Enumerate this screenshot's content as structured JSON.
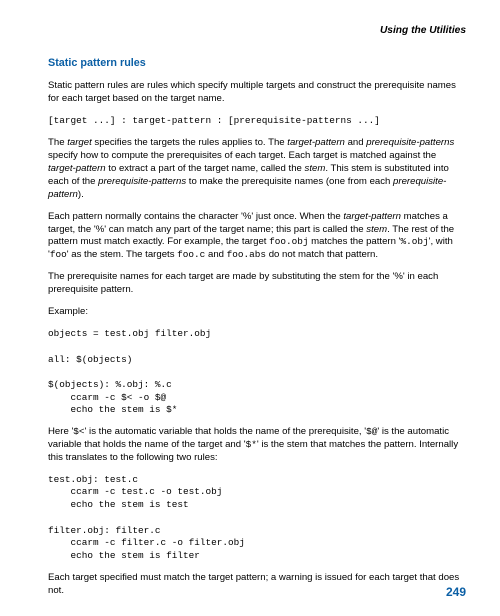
{
  "header": {
    "running_title": "Using the Utilities"
  },
  "section_title": "Static pattern rules",
  "p1": {
    "a": "Static pattern rules are rules which specify multiple targets and construct the prerequisite names for each target based on the target name."
  },
  "code1": "[target ...] : target-pattern : [prerequisite-patterns ...]",
  "p2": {
    "a": "The ",
    "e1": "target",
    "b": " specifies the targets the rules applies to. The ",
    "e2": "target-pattern",
    "c": " and ",
    "e3": "prerequisite-patterns",
    "d": " specify how to compute the prerequisites of each target. Each target is matched against the ",
    "e4": "target-pattern",
    "e": " to extract a part of the target name, called the ",
    "e5": "stem",
    "f": ". This stem is substituted into each of the ",
    "e6": "prerequisite-patterns",
    "g": " to make the prerequisite names (one from each ",
    "e7": "prerequisite-pattern",
    "h": ")."
  },
  "p3": {
    "a": "Each pattern normally contains the character '%' just once. When the ",
    "e1": "target-pattern",
    "b": " matches a target, the '%' can match any part of the target name; this part is called the ",
    "e2": "stem",
    "c": ". The rest of the pattern must match exactly. For example, the target ",
    "t1": "foo.obj",
    "d": " matches the pattern '",
    "t2": "%.obj",
    "e": "', with '",
    "t3": "foo",
    "f": "' as the stem. The targets ",
    "t4": "foo.c",
    "g": " and ",
    "t5": "foo.abs",
    "h": " do not match that pattern."
  },
  "p4": {
    "a": "The prerequisite names for each target are made by substituting the stem for the '%' in each prerequisite pattern."
  },
  "example_label": "Example:",
  "code2": "objects = test.obj filter.obj\n\nall: $(objects)\n\n$(objects): %.obj: %.c\n    ccarm -c $< -o $@\n    echo the stem is $*",
  "p5": {
    "a": "Here '",
    "t1": "$<",
    "b": "' is the automatic variable that holds the name of the prerequisite, '",
    "t2": "$@",
    "c": "' is the automatic variable that holds the name of the target and '",
    "t3": "$*",
    "d": "' is the stem that matches the pattern. Internally this translates to the following two rules:"
  },
  "code3": "test.obj: test.c\n    ccarm -c test.c -o test.obj\n    echo the stem is test\n\nfilter.obj: filter.c\n    ccarm -c filter.c -o filter.obj\n    echo the stem is filter",
  "p6": {
    "a": "Each target specified must match the target pattern; a warning is issued for each target that does not."
  },
  "page_number": "249"
}
